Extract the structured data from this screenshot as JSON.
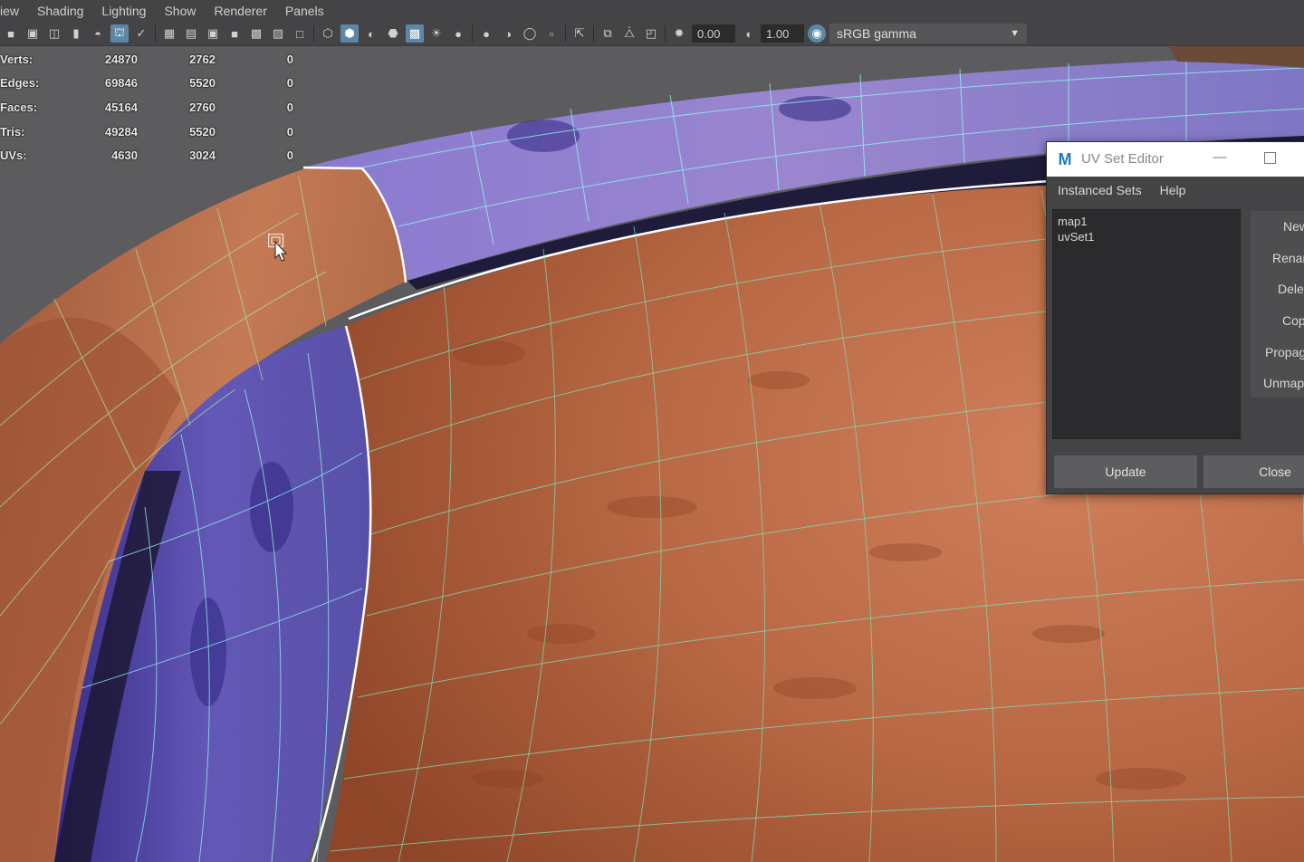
{
  "menubar": {
    "items": [
      "iew",
      "Shading",
      "Lighting",
      "Show",
      "Renderer",
      "Panels"
    ]
  },
  "toolbar": {
    "exposure_value": "0.00",
    "gamma_value": "1.00",
    "colorspace_label": "sRGB gamma",
    "icons": [
      "camera-icon",
      "camera-attrs-icon",
      "camera-bookmark-icon",
      "bookmark-icon",
      "image-plane-icon",
      "grid-toggle-icon",
      "2d-pan-icon",
      "wireframe-grid-icon",
      "film-gate-icon",
      "resolution-gate-icon",
      "gate-mask-icon",
      "field-chart-icon",
      "safe-action-icon",
      "safe-title-icon",
      "wireframe-icon",
      "smooth-shade-icon",
      "shade-default-material-icon",
      "wireframe-on-shaded-icon",
      "xray-icon",
      "use-all-lights-icon",
      "textured-icon",
      "shadows-icon",
      "screen-space-ao-icon",
      "motion-blur-icon",
      "antialias-icon",
      "isolate-select-icon",
      "xray-joints-icon",
      "xray-active-icon",
      "backface-culling-icon",
      "exposure-icon",
      "gamma-icon",
      "color-management-icon"
    ]
  },
  "hud": {
    "rows": [
      {
        "label": "Verts:",
        "c1": "24870",
        "c2": "2762",
        "c3": "0"
      },
      {
        "label": "Edges:",
        "c1": "69846",
        "c2": "5520",
        "c3": "0"
      },
      {
        "label": "Faces:",
        "c1": "45164",
        "c2": "2760",
        "c3": "0"
      },
      {
        "label": "Tris:",
        "c1": "49284",
        "c2": "5520",
        "c3": "0"
      },
      {
        "label": "UVs:",
        "c1": "4630",
        "c2": "3024",
        "c3": "0"
      }
    ]
  },
  "uv_editor": {
    "title": "UV Set Editor",
    "logo": "M",
    "menu": [
      "Instanced Sets",
      "Help"
    ],
    "uv_sets": [
      "map1",
      "uvSet1"
    ],
    "side_buttons": [
      "New",
      "Rename",
      "Delete",
      "Copy",
      "Propagate",
      "Unmap"
    ],
    "bottom_buttons": [
      "Update",
      "Close"
    ]
  },
  "colors": {
    "ui_bg": "#444446",
    "active_blue": "#5d87a7",
    "terracotta": "#b8653f",
    "uv_blue": "#6a6ac8",
    "wire": "#7de8c8"
  }
}
